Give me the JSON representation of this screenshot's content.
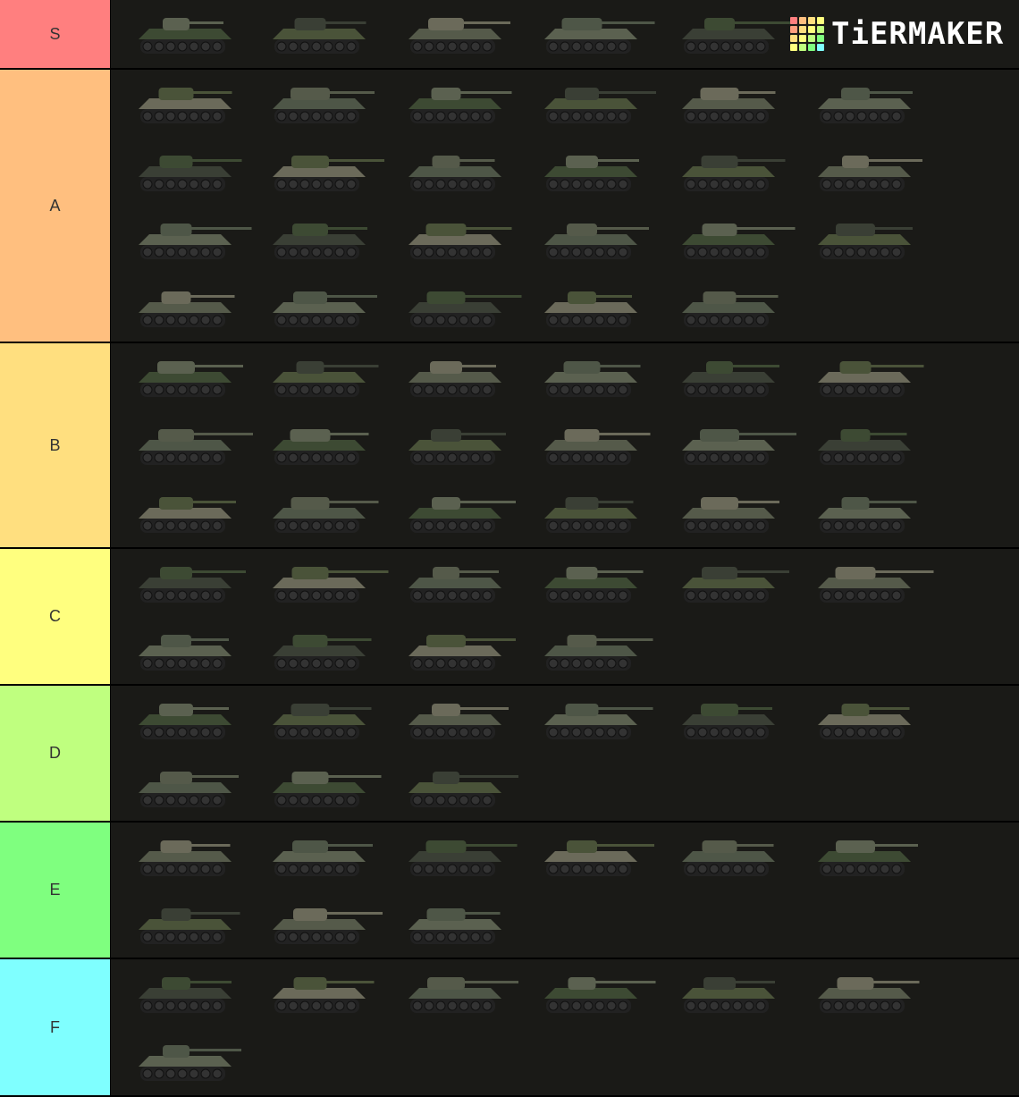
{
  "tiers": [
    {
      "label": "S",
      "color": "#ff7f7f",
      "count": 5
    },
    {
      "label": "A",
      "color": "#ffbf7f",
      "count": 23
    },
    {
      "label": "B",
      "color": "#ffdf7f",
      "count": 18
    },
    {
      "label": "C",
      "color": "#ffff7f",
      "count": 10
    },
    {
      "label": "D",
      "color": "#bfff7f",
      "count": 9
    },
    {
      "label": "E",
      "color": "#7fff7f",
      "count": 9
    },
    {
      "label": "F",
      "color": "#7fffff",
      "count": 7
    }
  ],
  "logo": {
    "text": "TiERMAKER",
    "colors": [
      "#ff7f7f",
      "#ffbf7f",
      "#ffdf7f",
      "#ffff7f",
      "#ff9f7f",
      "#ffdf7f",
      "#ffff7f",
      "#bfff7f",
      "#ffdf7f",
      "#ffff7f",
      "#bfff7f",
      "#7fff7f",
      "#ffff7f",
      "#bfff7f",
      "#7fff7f",
      "#7fffff"
    ]
  },
  "tile_icon": "tank-icon"
}
